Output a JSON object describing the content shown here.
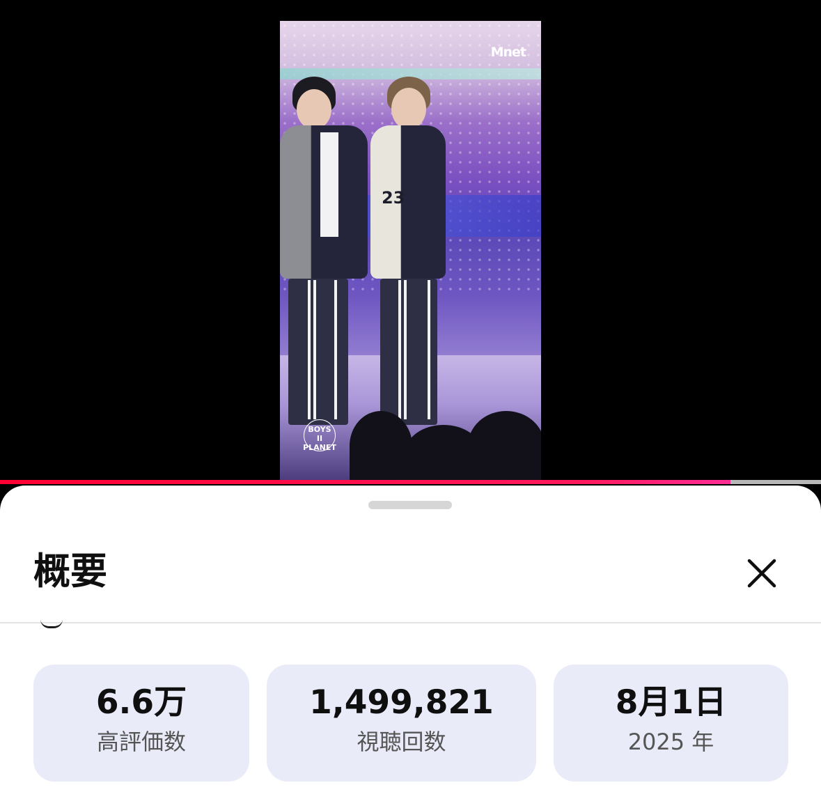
{
  "video": {
    "channel_logo": "Mnet",
    "show_logo_lines": [
      "BOYS",
      "II",
      "PLANET"
    ],
    "jersey_number": "23",
    "progress_fraction": 0.89
  },
  "sheet": {
    "title": "概要",
    "close_icon": "close-icon"
  },
  "stats": [
    {
      "value": "6.6万",
      "label": "高評価数"
    },
    {
      "value": "1,499,821",
      "label": "視聴回数"
    },
    {
      "value": "8月1日",
      "label": "2025 年"
    }
  ],
  "colors": {
    "progress": "#ff0033",
    "card_bg": "#e9ecf8",
    "sheet_bg": "#ffffff"
  }
}
